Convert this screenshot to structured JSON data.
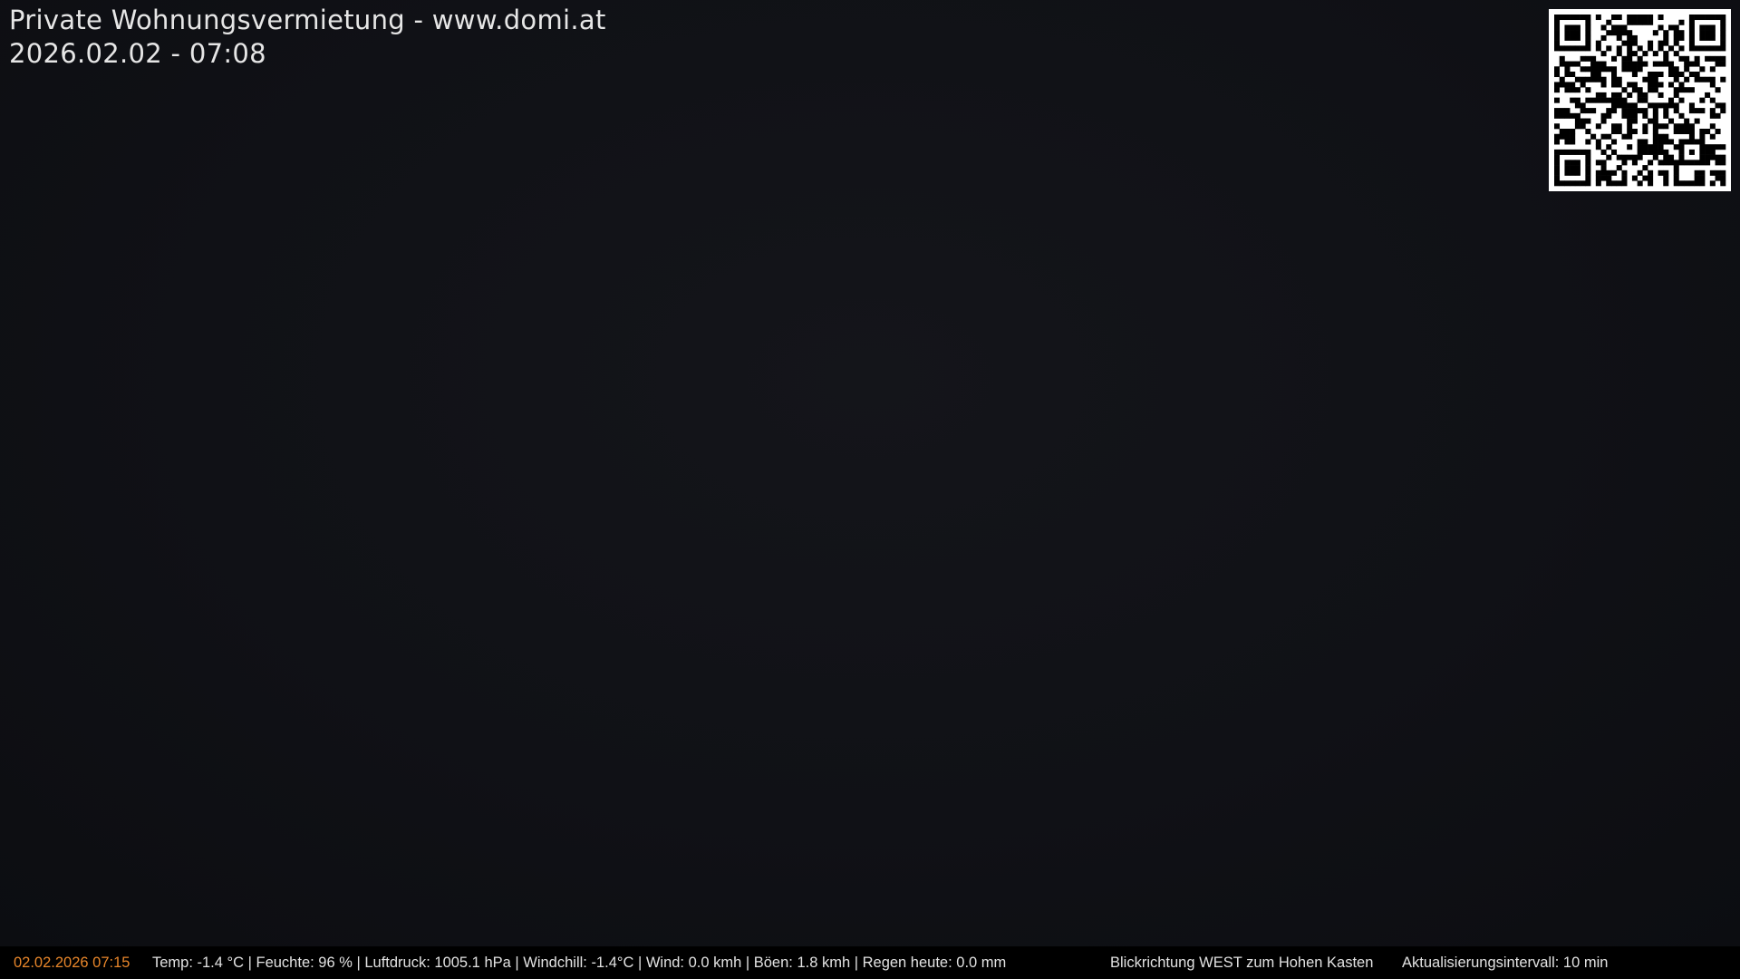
{
  "overlay": {
    "title": "Private Wohnungsvermietung - www.domi.at",
    "datetime": "2026.02.02 - 07:08"
  },
  "qr_code": {
    "icon": "qr-code-icon"
  },
  "status_bar": {
    "timestamp": "02.02.2026 07:15",
    "weather": "Temp: -1.4 °C  |  Feuchte: 96 %  |  Luftdruck: 1005.1 hPa  |  Windchill: -1.4°C  |  Wind: 0.0 kmh  |  Böen: 1.8 kmh  |  Regen heute: 0.0 mm",
    "view_direction": "Blickrichtung WEST zum Hohen Kasten",
    "update_interval": "Aktualisierungsintervall: 10 min"
  },
  "colors": {
    "image_background": "#101116",
    "status_background": "#000000",
    "timestamp": "#e8862a",
    "text": "#e2e2e2"
  }
}
